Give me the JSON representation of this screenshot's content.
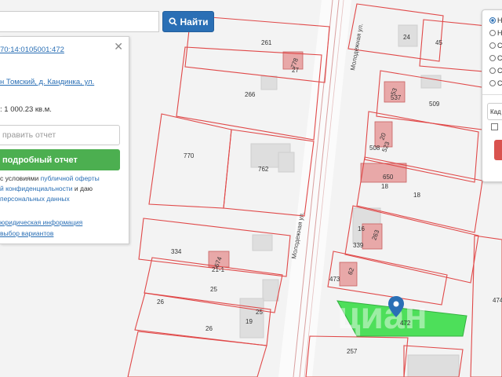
{
  "search": {
    "button_label": "Найти",
    "placeholder": ""
  },
  "info_panel": {
    "cadastral_number": "70:14:0105001:472",
    "address": "н Томский, д. Кандинка, ул.",
    "area": ": 1 000.23 кв.м.",
    "send_placeholder": "править отчет",
    "report_button": "подробный отчет",
    "consent_text_1": "с условиями ",
    "consent_link_1": "публичной оферты",
    "consent_link_2": "й конфиденциальности",
    "consent_text_2": " и даю",
    "consent_link_3": "персональных данных",
    "extra_link_1": "юридическая информация",
    "extra_link_2": "выбор вариантов"
  },
  "layer_panel": {
    "options": [
      "Н",
      "Н",
      "С",
      "С",
      "С",
      "С"
    ],
    "selected_index": 0,
    "cad_field_label": "Кад",
    "checkbox_checked": false
  },
  "map": {
    "plots": [
      "261",
      "778",
      "27",
      "266",
      "770",
      "762",
      "334",
      "674",
      "21-1",
      "25",
      "26",
      "19",
      "25",
      "26",
      "24",
      "45",
      "53",
      "537",
      "509",
      "20",
      "508",
      "523",
      "650",
      "18",
      "18",
      "16",
      "339",
      "263",
      "473",
      "62",
      "474",
      "472",
      "257"
    ],
    "streets": [
      "Молодежная ул.",
      "Молодежная ул."
    ],
    "watermark": "циан",
    "colors": {
      "building": "#e8a8a8",
      "selected_plot": "#4ddf5a",
      "boundary": "#e04848",
      "road": "#fbfbfb",
      "marker": "#2a6fb5"
    }
  }
}
